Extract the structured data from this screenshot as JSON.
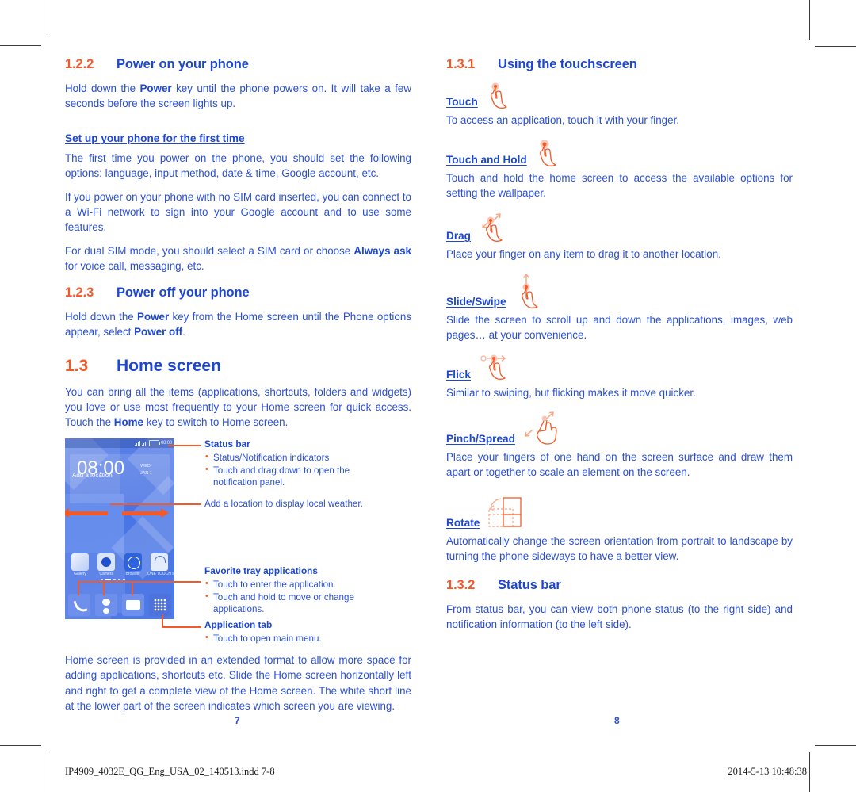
{
  "document": {
    "left_page_number": "7",
    "right_page_number": "8",
    "footer_filename": "IP4909_4032E_QG_Eng_USA_02_140513.indd   7-8",
    "footer_timestamp": "2014-5-13   10:48:38",
    "accent_orange": "#f15a29",
    "accent_blue": "#2a4fd6",
    "heading_blue": "#1c47d0"
  },
  "left_column": {
    "section_power_on": {
      "number": "1.2.2",
      "title": "Power on your phone",
      "paragraph_1_pre": "Hold down the ",
      "paragraph_1_bold": "Power",
      "paragraph_1_post": " key until the phone powers on. It will take a few seconds before the screen lights up.",
      "subheading": "Set up your phone for the first time",
      "paragraph_2": "The first time you power on the phone, you should set the following options: language, input method, date & time, Google account, etc.",
      "paragraph_3": "If you power on your phone with no SIM card inserted, you can connect to a Wi-Fi network to sign into your Google account and to use some features.",
      "paragraph_4_pre": "For dual SIM mode, you should select a SIM card or choose ",
      "paragraph_4_bold": "Always ask",
      "paragraph_4_post": " for voice call, messaging, etc."
    },
    "section_power_off": {
      "number": "1.2.3",
      "title": "Power off your phone",
      "paragraph_pre": "Hold down the ",
      "paragraph_bold_1": "Power",
      "paragraph_mid": " key from the Home screen until the Phone options appear, select ",
      "paragraph_bold_2": "Power off",
      "paragraph_post": "."
    },
    "section_home_screen": {
      "number": "1.3",
      "title": "Home screen",
      "intro_pre": "You can bring all the items (applications, shortcuts, folders and widgets) you love or use most frequently to your Home screen for quick access. Touch the ",
      "intro_bold": "Home",
      "intro_post": " key to switch to Home screen.",
      "closing_paragraph": "Home screen is provided in an extended format to allow more space for adding applications, shortcuts etc. Slide the Home screen horizontally left and right to get a complete view of the Home screen. The white short line at the lower part of the screen indicates which screen you are viewing."
    },
    "phone_mockup": {
      "status_time": "08:00",
      "clock_time": "08:00",
      "widget_meta_line1": "WED",
      "widget_meta_line2": "JAN 1",
      "add_location_label": "Add a location",
      "app_icons": [
        {
          "name": "gallery-icon",
          "label": "Gallery"
        },
        {
          "name": "camera-icon",
          "label": "Camera"
        },
        {
          "name": "browser-icon",
          "label": "Browser"
        },
        {
          "name": "store-icon",
          "label": "ONE TOUCH\nstore"
        }
      ],
      "tray_icons": [
        {
          "name": "phone-icon"
        },
        {
          "name": "contacts-icon"
        },
        {
          "name": "messaging-icon"
        },
        {
          "name": "app-drawer-icon"
        }
      ]
    },
    "callouts": [
      {
        "title": "Status bar",
        "bullets": [
          "Status/Notification indicators",
          "Touch and drag down to open the notification panel."
        ]
      },
      {
        "plain": "Add a location to display local weather."
      },
      {
        "title": "Favorite tray applications",
        "bullets": [
          "Touch to enter the application.",
          "Touch and hold to move or change applications."
        ]
      },
      {
        "title": "Application tab",
        "bullets": [
          "Touch to open main menu."
        ]
      }
    ]
  },
  "right_column": {
    "section_touchscreen": {
      "number": "1.3.1",
      "title": "Using the touchscreen"
    },
    "gestures": [
      {
        "label": "Touch",
        "icon": "touch-hand-icon",
        "description": "To access an application, touch it with your finger."
      },
      {
        "label": "Touch and Hold",
        "icon": "touch-and-hold-hand-icon",
        "description": "Touch and hold the home screen to access the available options for setting the wallpaper."
      },
      {
        "label": "Drag",
        "icon": "drag-hand-icon",
        "description": "Place your finger on any item to drag it to another location."
      },
      {
        "label": "Slide/Swipe",
        "icon": "slide-swipe-hand-icon",
        "description": "Slide the screen to scroll up and down the applications, images, web pages… at your convenience."
      },
      {
        "label": "Flick",
        "icon": "flick-hand-icon",
        "description": "Similar to swiping, but flicking makes it move quicker."
      },
      {
        "label": "Pinch/Spread",
        "icon": "pinch-spread-hand-icon",
        "description": "Place your fingers of one hand on the screen surface and draw them apart or together to scale an element on the screen."
      },
      {
        "label": "Rotate",
        "icon": "rotate-screen-icon",
        "description": "Automatically change the screen orientation from portrait to landscape by turning the phone sideways to have a better view."
      }
    ],
    "section_status_bar": {
      "number": "1.3.2",
      "title": "Status bar",
      "paragraph": "From status bar, you can view both phone status (to the right side) and notification information (to the left side)."
    }
  }
}
